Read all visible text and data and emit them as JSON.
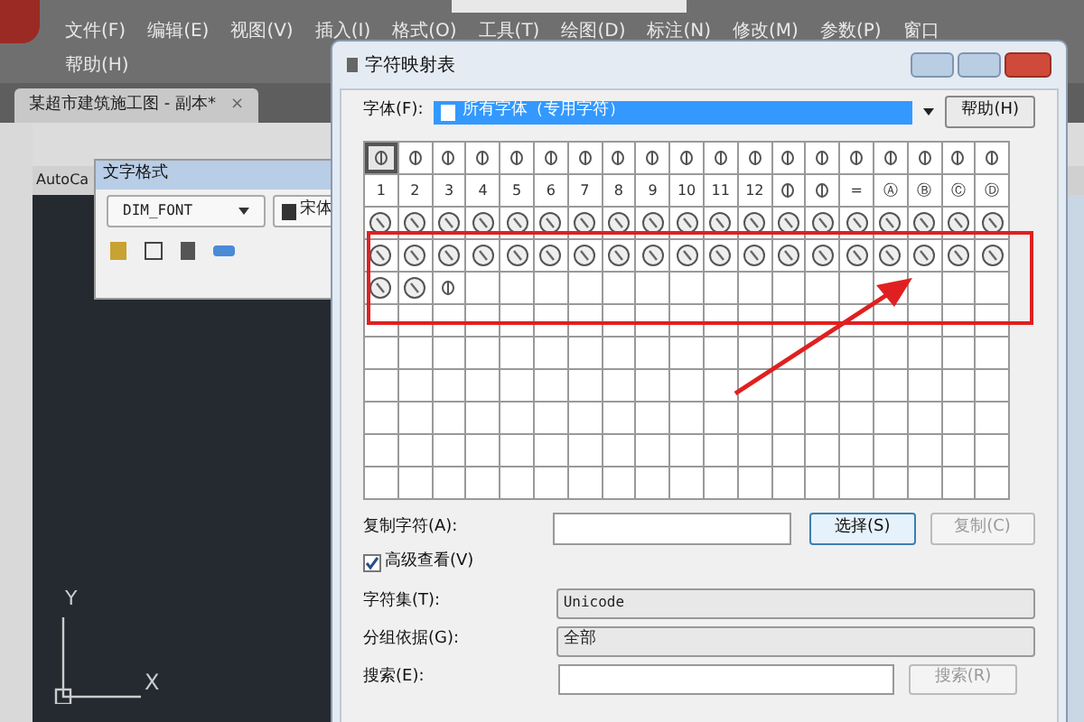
{
  "menu": {
    "items": [
      "文件(F)",
      "编辑(E)",
      "视图(V)",
      "插入(I)",
      "格式(O)",
      "工具(T)",
      "绘图(D)",
      "标注(N)",
      "修改(M)",
      "参数(P)",
      "窗口"
    ],
    "second_row": [
      "帮助(H)"
    ]
  },
  "document_tab": {
    "title": "某超市建筑施工图 - 副本*",
    "close": "×"
  },
  "workspace_label": "AutoCa",
  "text_format": {
    "title": "文字格式",
    "style": "DIM_FONT",
    "font": "宋体"
  },
  "ucs": {
    "y": "Y",
    "x": "X"
  },
  "dialog": {
    "title": "字符映射表",
    "font_label": "字体(F):",
    "font_value": "所有字体（专用字符）",
    "help_button": "帮助(H)",
    "grid": [
      [
        {
          "kind": "symbol",
          "selected": true
        },
        {
          "kind": "symbol",
          "selected": false
        },
        {
          "kind": "symbol",
          "selected": false
        },
        {
          "kind": "symbol",
          "selected": false
        },
        {
          "kind": "symbol",
          "selected": false
        },
        {
          "kind": "symbol",
          "selected": false
        },
        {
          "kind": "symbol",
          "selected": false
        },
        {
          "kind": "symbol",
          "selected": false
        },
        {
          "kind": "symbol",
          "selected": false
        },
        {
          "kind": "symbol",
          "selected": false
        },
        {
          "kind": "symbol",
          "selected": false
        },
        {
          "kind": "symbol",
          "selected": false
        },
        {
          "kind": "symbol",
          "selected": false
        },
        {
          "kind": "symbol",
          "selected": false
        },
        {
          "kind": "symbol",
          "selected": false
        },
        {
          "kind": "symbol",
          "selected": false
        },
        {
          "kind": "symbol",
          "selected": false
        },
        {
          "kind": "symbol",
          "selected": false
        },
        {
          "kind": "symbol",
          "selected": false
        }
      ],
      [
        {
          "kind": "char",
          "text": "1",
          "selected": false
        },
        {
          "kind": "char",
          "text": "2",
          "selected": false
        },
        {
          "kind": "char",
          "text": "3",
          "selected": false
        },
        {
          "kind": "char",
          "text": "4",
          "selected": false
        },
        {
          "kind": "char",
          "text": "5",
          "selected": false
        },
        {
          "kind": "char",
          "text": "6",
          "selected": false
        },
        {
          "kind": "char",
          "text": "7",
          "selected": false
        },
        {
          "kind": "char",
          "text": "8",
          "selected": false
        },
        {
          "kind": "char",
          "text": "9",
          "selected": false
        },
        {
          "kind": "char",
          "text": "10",
          "selected": false
        },
        {
          "kind": "char",
          "text": "11",
          "selected": false
        },
        {
          "kind": "char",
          "text": "12",
          "selected": false
        },
        {
          "kind": "symbol",
          "selected": false
        },
        {
          "kind": "symbol",
          "selected": false
        },
        {
          "kind": "char",
          "text": "=",
          "selected": false
        },
        {
          "kind": "char",
          "text": "Ⓐ",
          "selected": false
        },
        {
          "kind": "char",
          "text": "Ⓑ",
          "selected": false
        },
        {
          "kind": "char",
          "text": "Ⓒ",
          "selected": false
        },
        {
          "kind": "char",
          "text": "Ⓓ",
          "selected": false
        }
      ],
      [
        {
          "kind": "circled",
          "selected": false
        },
        {
          "kind": "circled",
          "selected": false
        },
        {
          "kind": "circled",
          "selected": false
        },
        {
          "kind": "circled",
          "selected": false
        },
        {
          "kind": "circled",
          "selected": false
        },
        {
          "kind": "circled",
          "selected": false
        },
        {
          "kind": "circled",
          "selected": false
        },
        {
          "kind": "circled",
          "selected": false
        },
        {
          "kind": "circled",
          "selected": false
        },
        {
          "kind": "circled",
          "selected": false
        },
        {
          "kind": "circled",
          "selected": false
        },
        {
          "kind": "circled",
          "selected": false
        },
        {
          "kind": "circled",
          "selected": false
        },
        {
          "kind": "circled",
          "selected": false
        },
        {
          "kind": "circled",
          "selected": false
        },
        {
          "kind": "circled",
          "selected": false
        },
        {
          "kind": "circled",
          "selected": false
        },
        {
          "kind": "circled",
          "selected": false
        },
        {
          "kind": "circled",
          "selected": false
        }
      ],
      [
        {
          "kind": "circled",
          "selected": false
        },
        {
          "kind": "circled",
          "selected": false
        },
        {
          "kind": "circled",
          "selected": false
        },
        {
          "kind": "circled",
          "selected": false
        },
        {
          "kind": "circled",
          "selected": false
        },
        {
          "kind": "circled",
          "selected": false
        },
        {
          "kind": "circled",
          "selected": false
        },
        {
          "kind": "circled",
          "selected": false
        },
        {
          "kind": "circled",
          "selected": false
        },
        {
          "kind": "circled",
          "selected": false
        },
        {
          "kind": "circled",
          "selected": false
        },
        {
          "kind": "circled",
          "selected": false
        },
        {
          "kind": "circled",
          "selected": false
        },
        {
          "kind": "circled",
          "selected": false
        },
        {
          "kind": "circled",
          "selected": false
        },
        {
          "kind": "circled",
          "selected": false
        },
        {
          "kind": "circled",
          "selected": false
        },
        {
          "kind": "circled",
          "selected": false
        },
        {
          "kind": "circled",
          "selected": false
        }
      ],
      [
        {
          "kind": "circled",
          "selected": false
        },
        {
          "kind": "circled",
          "selected": false
        },
        {
          "kind": "symbol",
          "selected": false
        }
      ]
    ],
    "copy_label": "复制字符(A):",
    "select_button": "选择(S)",
    "copy_button": {
      "label": "复制(C)",
      "disabled": true
    },
    "advanced": {
      "label": "高级查看(V)",
      "checked": true
    },
    "charset_label": "字符集(T):",
    "charset_value": "Unicode",
    "group_label": "分组依据(G):",
    "group_value": "全部",
    "search_label": "搜索(E):",
    "search_button": {
      "label": "搜索(R)",
      "disabled": true
    }
  }
}
